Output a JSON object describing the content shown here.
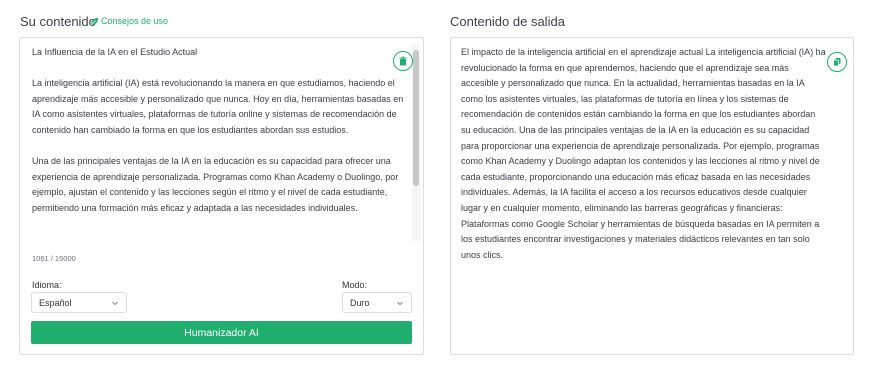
{
  "left_panel": {
    "title": "Su contenido",
    "tips_label": "Consejos de uso",
    "input_text": "La Influencia de la IA en el Estudio Actual\n\nLa inteligencia artificial (IA) está revolucionando la manera en que estudiamos, haciendo el aprendizaje más accesible y personalizado que nunca. Hoy en día, herramientas basadas en IA como asistentes virtuales, plataformas de tutoría online y sistemas de recomendación de contenido han cambiado la forma en que los estudiantes abordan sus estudios.\n\nUna de las principales ventajas de la IA en la educación es su capacidad para ofrecer una experiencia de aprendizaje personalizada. Programas como Khan Academy o Duolingo, por ejemplo, ajustan el contenido y las lecciones según el ritmo y el nivel de cada estudiante, permitiendo una formación más eficaz y adaptada a las necesidades individuales.",
    "char_count": "1061 / 15000",
    "language_label": "Idioma:",
    "language_value": "Español",
    "mode_label": "Modo:",
    "mode_value": "Duro",
    "action_label": "Humanizador AI"
  },
  "right_panel": {
    "title": "Contenido de salida",
    "output_text": "El impacto de la inteligencia artificial en el aprendizaje actual La inteligencia artificial (IA) ha revolucionado la forma en que aprendemos, haciendo que el aprendizaje sea más accesible y personalizado que nunca. En la actualidad, herramientas basadas en la IA como los asistentes virtuales, las plataformas de tutoría en línea y los sistemas de recomendación de contenidos están cambiando la forma en que los estudiantes abordan su educación. Una de las principales ventajas de la IA en la educación es su capacidad para proporcionar una experiencia de aprendizaje personalizada. Por ejemplo, programas como Khan Academy y Duolingo adaptan los contenidos y las lecciones al ritmo y nivel de cada estudiante, proporcionando una educación más eficaz basada en las necesidades individuales. Además, la IA facilita el acceso a los recursos educativos desde cualquier lugar y en cualquier momento, eliminando las barreras geográficas y financieras: Plataformas como Google Scholar y herramientas de búsqueda basadas en IA permiten a los estudiantes encontrar investigaciones y materiales didácticos relevantes en tan solo unos clics."
  },
  "colors": {
    "accent": "#1fae6d",
    "border": "#d9dde3"
  },
  "icons": {
    "tips": "leaf-icon",
    "delete": "trash-icon",
    "copy": "copy-icon",
    "dropdown": "chevron-down-icon"
  }
}
